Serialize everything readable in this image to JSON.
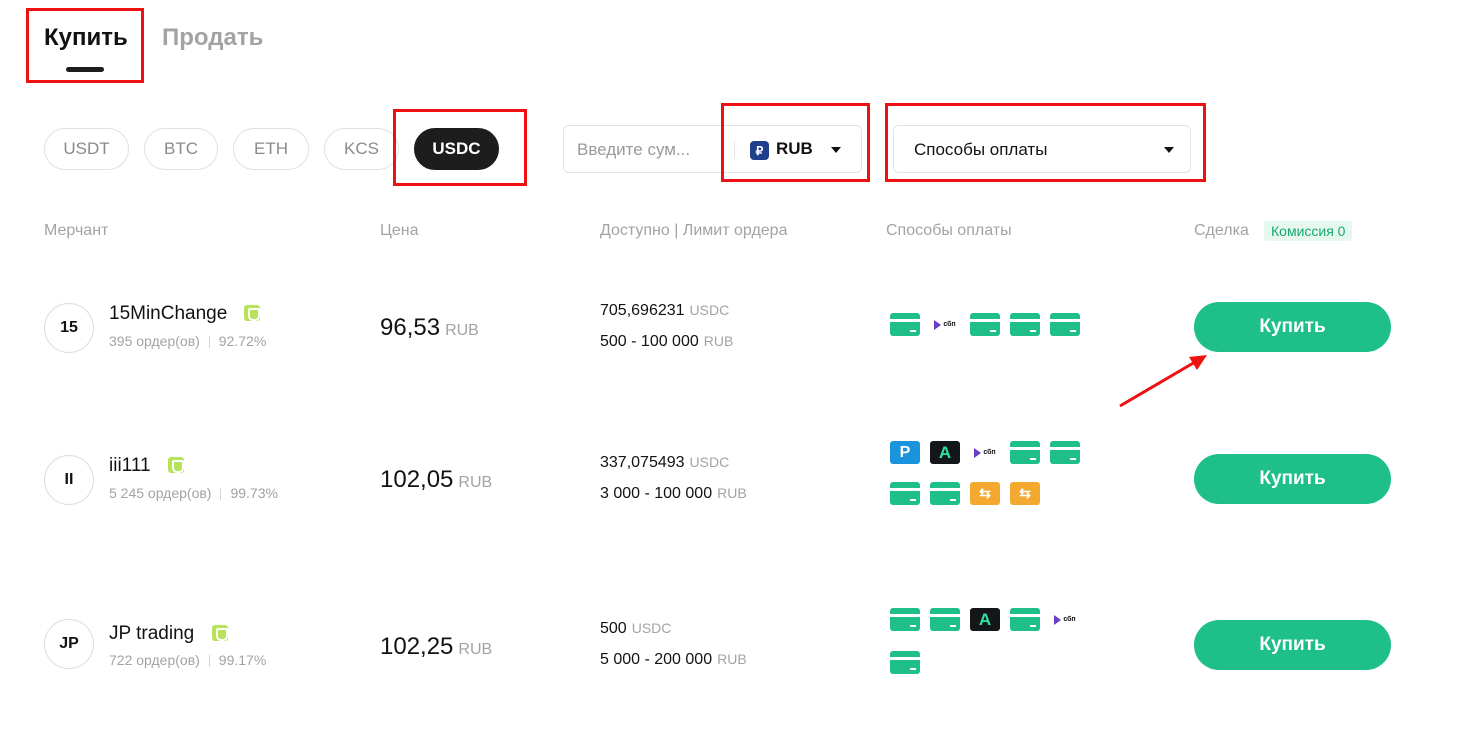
{
  "tabs": {
    "buy": "Купить",
    "sell": "Продать"
  },
  "coins": [
    "USDT",
    "BTC",
    "ETH",
    "KCS",
    "USDC"
  ],
  "active_coin": "USDC",
  "amount": {
    "placeholder": "Введите сум...",
    "currency": "RUB",
    "currency_symbol": "₽"
  },
  "payment_filter": {
    "label": "Способы оплаты"
  },
  "headers": {
    "merchant": "Мерчант",
    "price": "Цена",
    "available": "Доступно | Лимит ордера",
    "payment": "Способы оплаты",
    "deal": "Сделка",
    "fee_badge": "Комиссия 0"
  },
  "rows": [
    {
      "avatar": "15",
      "name": "15MinChange",
      "orders": "395 ордер(ов)",
      "completion": "92.72%",
      "price": "96,53",
      "price_unit": "RUB",
      "available": "705,696231",
      "available_unit": "USDC",
      "limit": "500 - 100 000",
      "limit_unit": "RUB",
      "payment_icons": [
        "bank-card",
        "sbp",
        "bank-card",
        "bank-card",
        "bank-card"
      ],
      "button": "Купить"
    },
    {
      "avatar": "II",
      "name": "iii111",
      "orders": "5 245 ордер(ов)",
      "completion": "99.73%",
      "price": "102,05",
      "price_unit": "RUB",
      "available": "337,075493",
      "available_unit": "USDC",
      "limit": "3 000 - 100 000",
      "limit_unit": "RUB",
      "payment_icons": [
        "parking-p",
        "advcash-a",
        "sbp",
        "bank-card",
        "bank-card",
        "bank-card",
        "bank-card",
        "exchange",
        "exchange"
      ],
      "button": "Купить"
    },
    {
      "avatar": "JP",
      "name": "JP trading",
      "orders": "722 ордер(ов)",
      "completion": "99.17%",
      "price": "102,25",
      "price_unit": "RUB",
      "available": "500",
      "available_unit": "USDC",
      "limit": "5 000 - 200 000",
      "limit_unit": "RUB",
      "payment_icons": [
        "bank-card",
        "bank-card",
        "advcash-a",
        "bank-card",
        "sbp",
        "bank-card"
      ],
      "button": "Купить"
    }
  ],
  "icon_text": {
    "sbp": "сбп",
    "parking": "P",
    "advcash": "A",
    "exchange": "⇆"
  },
  "colors": {
    "accent": "#1fbf8a",
    "annotation": "#ee1111",
    "verified": "#b6e35a",
    "fee_badge_bg": "#e5f7ef"
  }
}
